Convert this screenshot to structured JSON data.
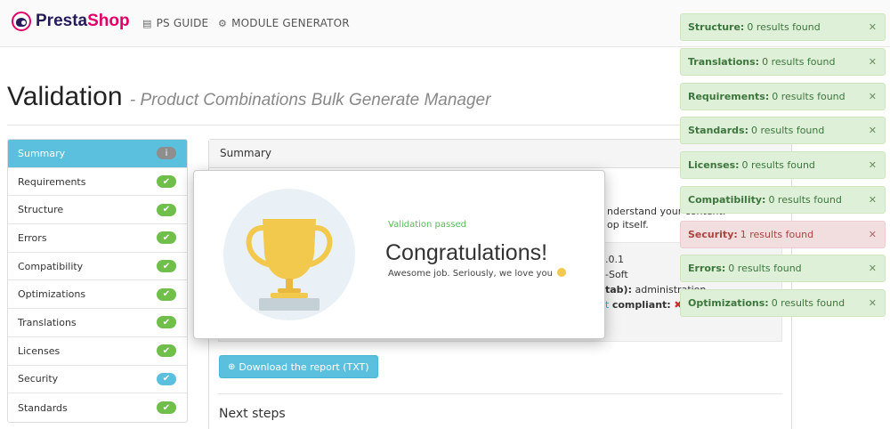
{
  "header": {
    "logo_part1": "Presta",
    "logo_part2": "Shop",
    "nav": [
      {
        "label": "PS GUIDE",
        "icon": "book-icon"
      },
      {
        "label": "MODULE GENERATOR",
        "icon": "gears-icon"
      }
    ]
  },
  "page": {
    "title": "Validation",
    "subtitle": "- Product Combinations Bulk Generate Manager"
  },
  "sidebar": {
    "items": [
      {
        "label": "Summary",
        "status": "info",
        "active": true
      },
      {
        "label": "Requirements",
        "status": "ok"
      },
      {
        "label": "Structure",
        "status": "ok"
      },
      {
        "label": "Errors",
        "status": "ok"
      },
      {
        "label": "Compatibility",
        "status": "ok"
      },
      {
        "label": "Optimizations",
        "status": "ok"
      },
      {
        "label": "Translations",
        "status": "ok"
      },
      {
        "label": "Licenses",
        "status": "ok"
      },
      {
        "label": "Security",
        "status": "info"
      },
      {
        "label": "Standards",
        "status": "ok"
      }
    ]
  },
  "panel": {
    "heading": "Summary",
    "partial_line1": "nderstand your content.",
    "partial_line2": "op itself.",
    "partial_version": ".0.1",
    "partial_author": "-Soft",
    "partial_tab_bold": "tab):",
    "partial_tab_value": "administration",
    "partial_compliant_link": "t",
    "partial_compliant_bold": "compliant:",
    "download_label": "Download the report (TXT)",
    "next_steps": "Next steps"
  },
  "modal": {
    "status": "Validation passed",
    "title": "Congratulations!",
    "message": "Awesome job. Seriously, we love you"
  },
  "notifications": [
    {
      "label": "Structure:",
      "text": "0 results found",
      "type": "success"
    },
    {
      "label": "Translations:",
      "text": "0 results found",
      "type": "success"
    },
    {
      "label": "Requirements:",
      "text": "0 results found",
      "type": "success"
    },
    {
      "label": "Standards:",
      "text": "0 results found",
      "type": "success"
    },
    {
      "label": "Licenses:",
      "text": "0 results found",
      "type": "success"
    },
    {
      "label": "Compatibility:",
      "text": "0 results found",
      "type": "success"
    },
    {
      "label": "Security:",
      "text": "1 results found",
      "type": "danger"
    },
    {
      "label": "Errors:",
      "text": "0 results found",
      "type": "success"
    },
    {
      "label": "Optimizations:",
      "text": "0 results found",
      "type": "success"
    }
  ],
  "colors": {
    "info": "#5bc0de",
    "success": "#6fbf4a",
    "success_bg": "#dff0d8",
    "danger_bg": "#f2dede",
    "brand_navy": "#251b5b",
    "brand_pink": "#df0067"
  }
}
